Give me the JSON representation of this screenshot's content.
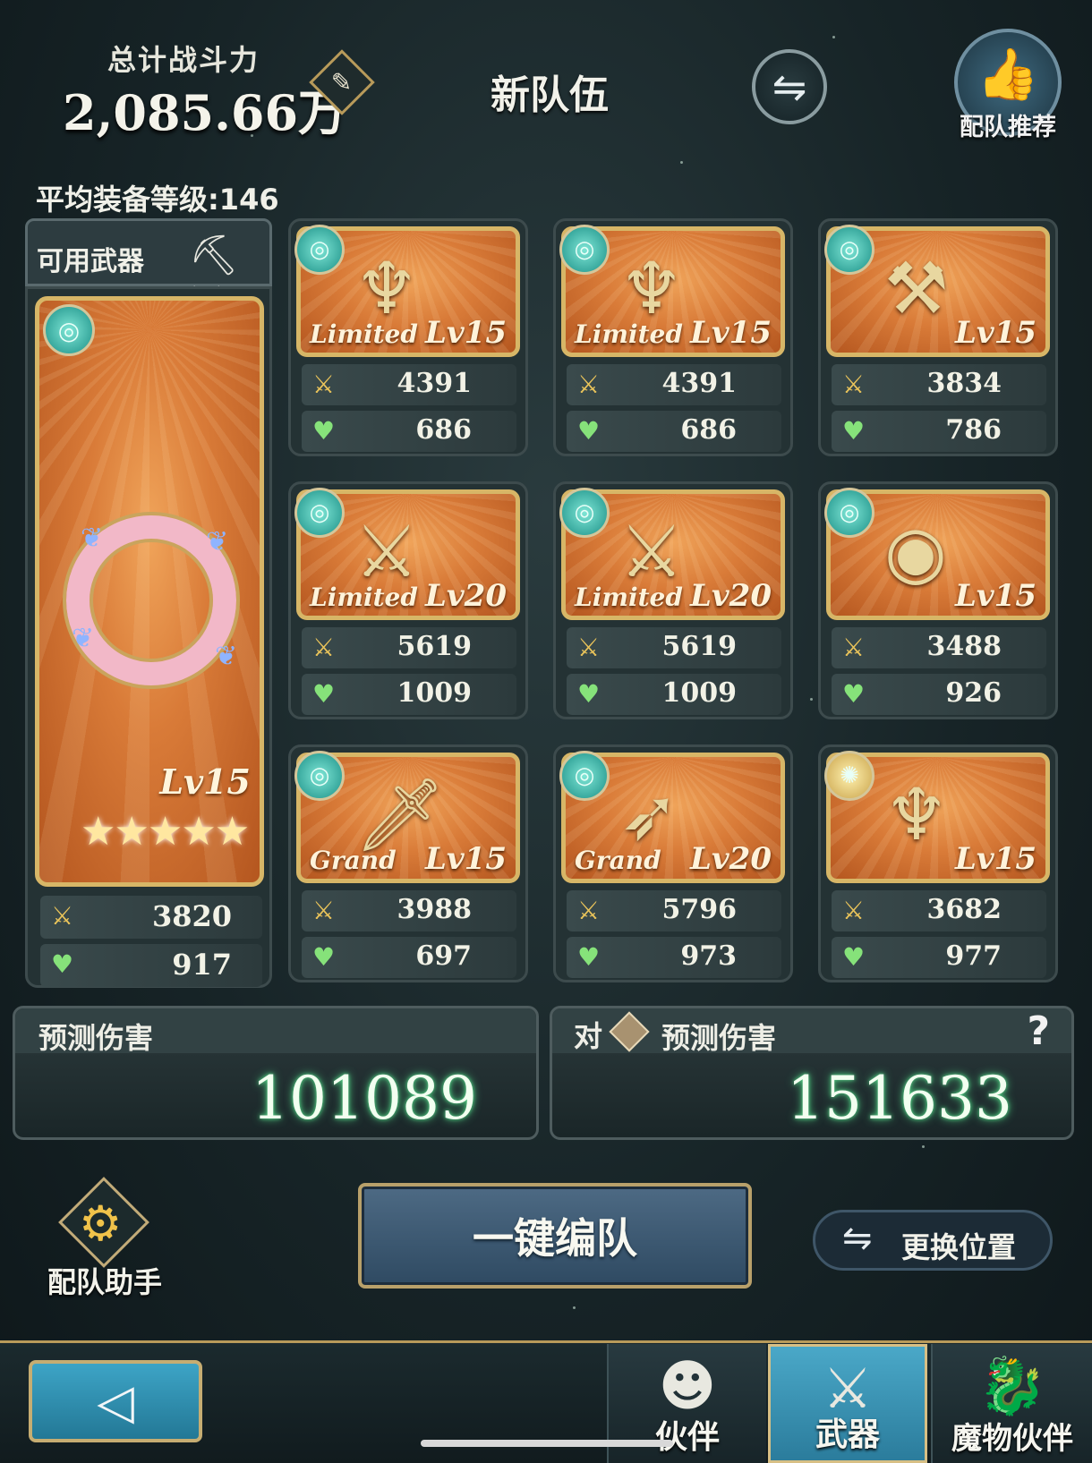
{
  "header": {
    "power_label": "总计战斗力",
    "power_value": "2,085.66万",
    "team_name": "新队伍",
    "recommend_label": "配队推荐",
    "avg_level_text": "平均装备等级:146"
  },
  "filter": {
    "label": "可用武器",
    "icons": [
      "pickaxe-icon",
      "crossed-swords-icon"
    ]
  },
  "main_weapon": {
    "element": "wind",
    "level": "Lv15",
    "stars": "★★★★★",
    "attack": "3820",
    "hp": "917"
  },
  "weapons": [
    {
      "tag": "Limited",
      "level": "Lv15",
      "attack": "4391",
      "hp": "686",
      "element": "wind",
      "icon": "lyre-icon"
    },
    {
      "tag": "Limited",
      "level": "Lv15",
      "attack": "4391",
      "hp": "686",
      "element": "wind",
      "icon": "lyre-icon"
    },
    {
      "tag": "",
      "level": "Lv15",
      "attack": "3834",
      "hp": "786",
      "element": "wind",
      "icon": "axe-icon"
    },
    {
      "tag": "Limited",
      "level": "Lv20",
      "attack": "5619",
      "hp": "1009",
      "element": "wind",
      "icon": "rapier-icon"
    },
    {
      "tag": "Limited",
      "level": "Lv20",
      "attack": "5619",
      "hp": "1009",
      "element": "wind",
      "icon": "rapier-icon"
    },
    {
      "tag": "",
      "level": "Lv15",
      "attack": "3488",
      "hp": "926",
      "element": "wind",
      "icon": "drum-icon"
    },
    {
      "tag": "Grand",
      "level": "Lv15",
      "attack": "3988",
      "hp": "697",
      "element": "wind",
      "icon": "sword-icon"
    },
    {
      "tag": "Grand",
      "level": "Lv20",
      "attack": "5796",
      "hp": "973",
      "element": "wind",
      "icon": "spear-icon"
    },
    {
      "tag": "",
      "level": "Lv15",
      "attack": "3682",
      "hp": "977",
      "element": "light",
      "icon": "harp-icon"
    }
  ],
  "damage": {
    "predicted_label": "预测伤害",
    "predicted_value": "101089",
    "versus_label": "对",
    "versus_predicted_label": "预测伤害",
    "versus_value": "151633",
    "help": "?"
  },
  "controls": {
    "assistant_label": "配队助手",
    "auto_button": "一键编队",
    "swap_position": "更换位置"
  },
  "nav": {
    "tabs": [
      {
        "label": "伙伴",
        "icon": "character-icon",
        "active": false
      },
      {
        "label": "武器",
        "icon": "weapons-icon",
        "active": true
      },
      {
        "label": "魔物伙伴",
        "icon": "dragon-icon",
        "active": false
      }
    ]
  },
  "colors": {
    "frame_gold": "#d7b667",
    "card_orange": "#d97b38",
    "wind_element": "#3fc4b4",
    "damage_glow": "#4ccf80",
    "active_tab": "#4aa8c8"
  }
}
